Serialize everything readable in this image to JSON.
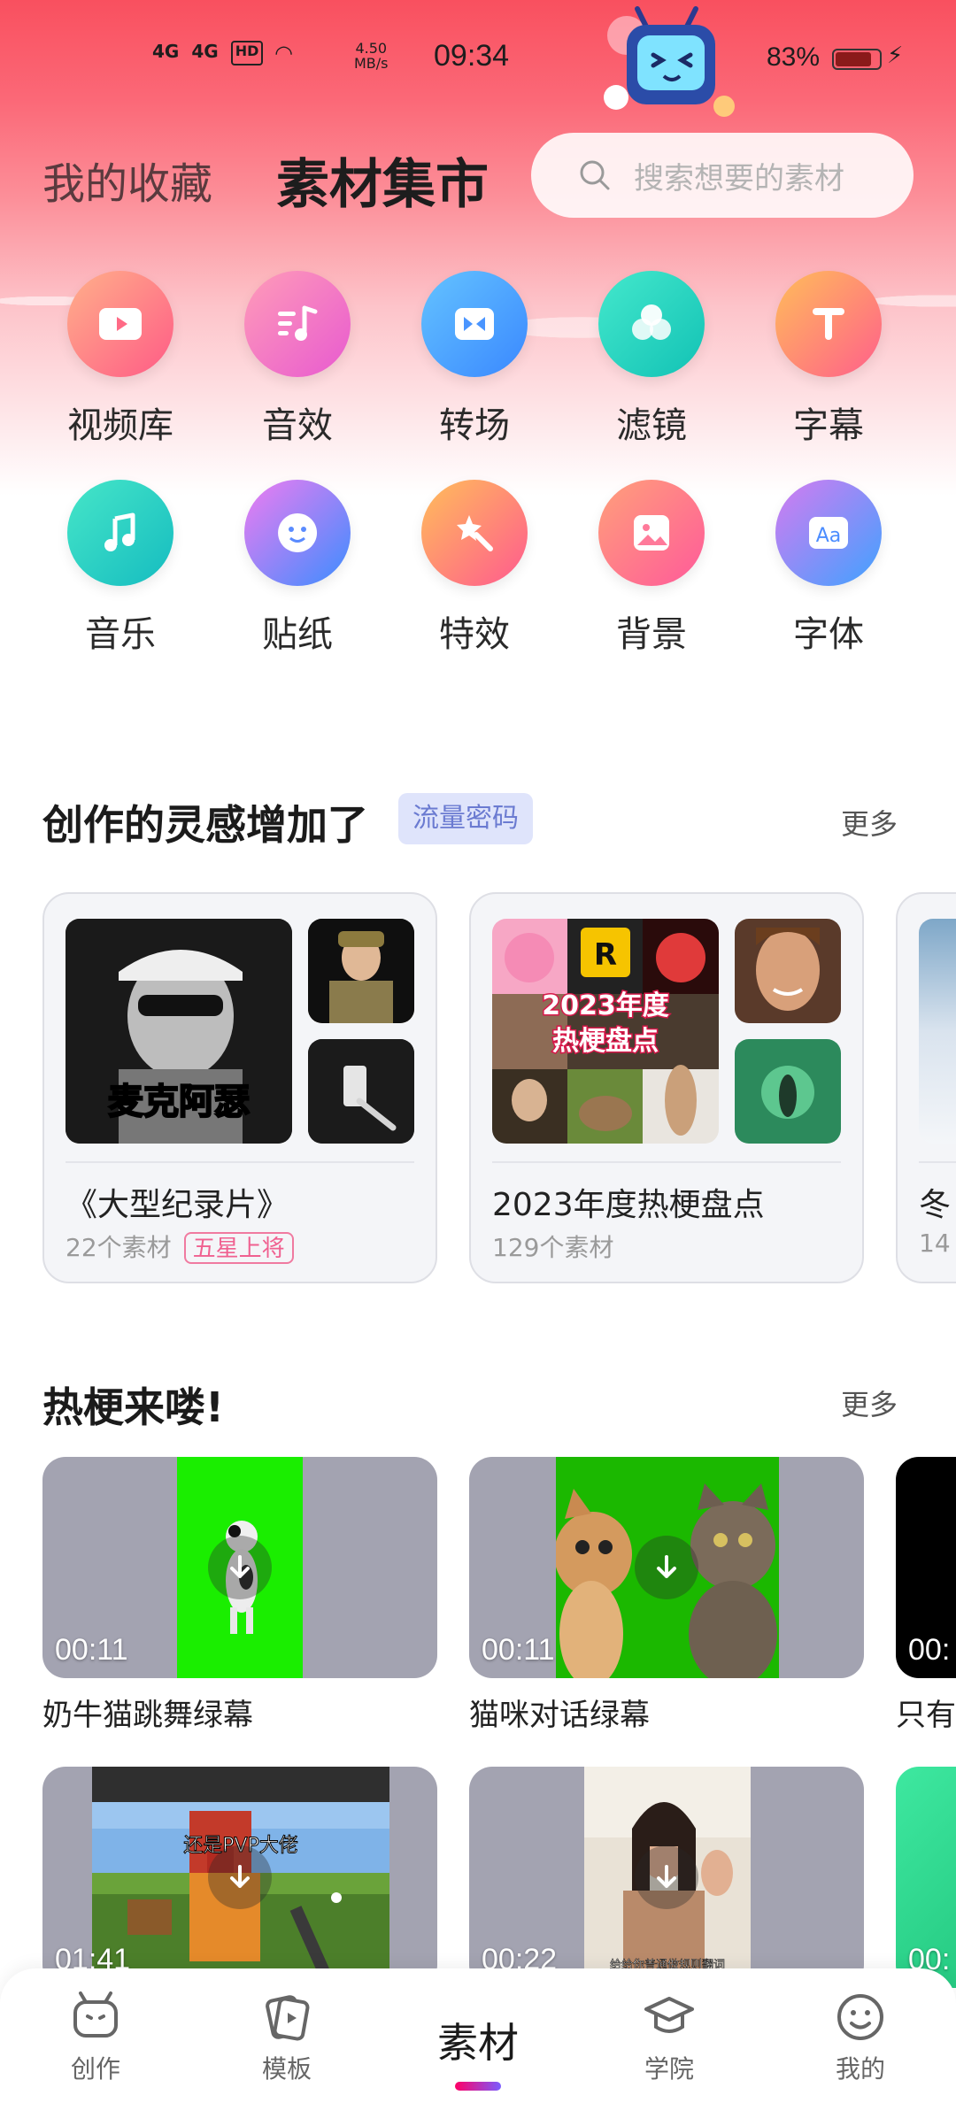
{
  "status_bar": {
    "signal1": "4G",
    "signal2": "4G",
    "hd": "HD",
    "net_speed_value": "4.50",
    "net_speed_unit": "MB/s",
    "time": "09:34",
    "battery": "83%"
  },
  "header": {
    "tab_favorites": "我的收藏",
    "tab_market": "素材集市",
    "search_placeholder": "搜索想要的素材"
  },
  "categories": [
    {
      "label": "视频库",
      "icon": "video-play-icon",
      "color_from": "#ff8a8a",
      "color_to": "#ff5b86"
    },
    {
      "label": "音效",
      "icon": "sound-effect-icon",
      "color_from": "#ff8fb0",
      "color_to": "#f05cc8"
    },
    {
      "label": "转场",
      "icon": "transition-icon",
      "color_from": "#5ab6ff",
      "color_to": "#3d8dff"
    },
    {
      "label": "滤镜",
      "icon": "filter-icon",
      "color_from": "#3ee3c7",
      "color_to": "#17c6b8"
    },
    {
      "label": "字幕",
      "icon": "subtitle-icon",
      "color_from": "#ffb15a",
      "color_to": "#ff5f8b"
    },
    {
      "label": "音乐",
      "icon": "music-icon",
      "color_from": "#3ee0c6",
      "color_to": "#18c0c0"
    },
    {
      "label": "贴纸",
      "icon": "sticker-icon",
      "color_from": "#f07cf0",
      "color_to": "#3b8dff"
    },
    {
      "label": "特效",
      "icon": "effect-wand-icon",
      "color_from": "#ffb45a",
      "color_to": "#ff5a8f"
    },
    {
      "label": "背景",
      "icon": "background-image-icon",
      "color_from": "#ff9b7a",
      "color_to": "#ff5a9a"
    },
    {
      "label": "字体",
      "icon": "font-icon",
      "color_from": "#d57bf0",
      "color_to": "#3fa2ff"
    }
  ],
  "inspiration": {
    "title": "创作的灵感增加了",
    "tag": "流量密码",
    "more": "更多",
    "collections": [
      {
        "name": "《大型纪录片》",
        "count": "22个素材",
        "badge": "五星上将",
        "overlay": "麦克阿瑟"
      },
      {
        "name": "2023年度热梗盘点",
        "count": "129个素材",
        "badge": "",
        "overlay": "2023年度 热梗盘点"
      },
      {
        "name": "冬",
        "count": "14",
        "badge": "",
        "overlay": ""
      }
    ]
  },
  "hot_memes": {
    "title": "热梗来喽!",
    "more": "更多",
    "row1": [
      {
        "duration": "00:11",
        "title": "奶牛猫跳舞绿幕"
      },
      {
        "duration": "00:11",
        "title": "猫咪对话绿幕"
      },
      {
        "duration": "00:",
        "title": "只有"
      }
    ],
    "row2": [
      {
        "duration": "01:41",
        "title": "",
        "caption": "还是PVP大佬"
      },
      {
        "duration": "00:22",
        "title": "",
        "caption": "给给你普通做规则翻词"
      },
      {
        "duration": "00:",
        "title": ""
      }
    ]
  },
  "bottom_nav": {
    "create": "创作",
    "template": "模板",
    "material": "素材",
    "academy": "学院",
    "mine": "我的"
  },
  "colors": {
    "brand_pink": "#f9505f",
    "tag_bg": "#dfe4fb",
    "tag_text": "#6b7bd1",
    "badge_pink": "#f06090",
    "green_screen": "#1aee00"
  }
}
